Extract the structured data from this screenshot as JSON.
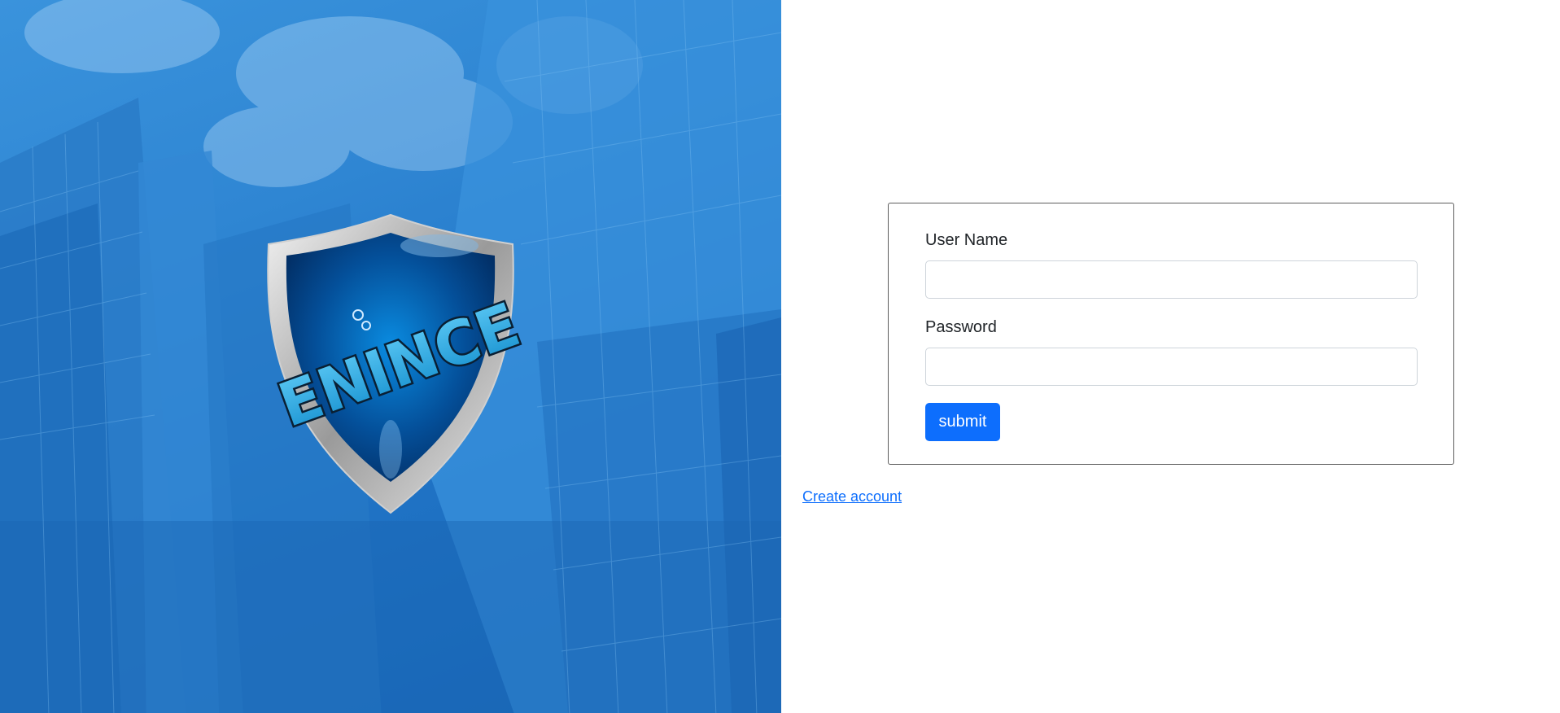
{
  "hero": {
    "logo_text": "ENINCE",
    "background_color": "#2f86d3",
    "image_description_icon": "city-buildings-image"
  },
  "login_form": {
    "username_label": "User Name",
    "username_value": "",
    "username_placeholder": "",
    "password_label": "Password",
    "password_value": "",
    "password_placeholder": "",
    "submit_label": "submit"
  },
  "links": {
    "create_account": "Create account"
  },
  "colors": {
    "primary": "#0d6efd",
    "card_border": "#5d5d5d",
    "input_border": "#ced4da"
  }
}
